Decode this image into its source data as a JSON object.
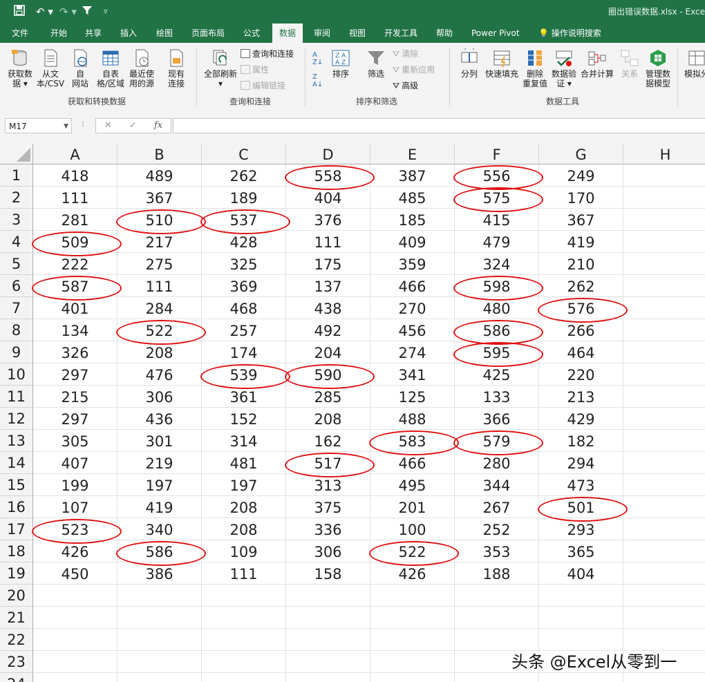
{
  "titlebar": {
    "filename": "圈出错误数据.xlsx",
    "app": "Exce"
  },
  "tabs": [
    "文件",
    "开始",
    "共享",
    "插入",
    "绘图",
    "页面布局",
    "公式",
    "数据",
    "审阅",
    "视图",
    "开发工具",
    "帮助",
    "Power Pivot",
    "操作说明搜索"
  ],
  "active_tab": "数据",
  "ribbon": {
    "get_data": "获取数\n据",
    "from_csv": "从文\n本/CSV",
    "from_web": "自\n网站",
    "from_table": "自表\n格/区域",
    "recent_sources": "最近使\n用的源",
    "existing": "现有\n连接",
    "group_get": "获取和转换数据",
    "refresh_all": "全部刷新",
    "queries_conn": "查询和连接",
    "properties": "属性",
    "edit_links": "编辑链接",
    "group_queries": "查询和连接",
    "sort_az": "A→Z",
    "sort": "排序",
    "filter": "筛选",
    "clear": "清除",
    "reapply": "重新应用",
    "advanced": "高级",
    "group_sort": "排序和筛选",
    "text_to_col": "分列",
    "flash_fill": "快速填充",
    "remove_dup": "删除\n重复值",
    "validation": "数据验\n证",
    "consolidate": "合并计算",
    "relationships": "关系",
    "data_model": "管理数\n据模型",
    "group_tools": "数据工具",
    "whatif": "模拟分"
  },
  "namebox": "M17",
  "formula_icons": {
    "cancel": "✕",
    "enter": "✓",
    "fx": "fx"
  },
  "columns": [
    "A",
    "B",
    "C",
    "D",
    "E",
    "F",
    "G",
    "H"
  ],
  "row_numbers": [
    "1",
    "2",
    "3",
    "4",
    "5",
    "6",
    "7",
    "8",
    "9",
    "10",
    "11",
    "12",
    "13",
    "14",
    "15",
    "16",
    "17",
    "18",
    "19",
    "20",
    "21",
    "22",
    "23",
    "24"
  ],
  "rows": [
    [
      "418",
      "489",
      "262",
      "558",
      "387",
      "556",
      "249"
    ],
    [
      "111",
      "367",
      "189",
      "404",
      "485",
      "575",
      "170"
    ],
    [
      "281",
      "510",
      "537",
      "376",
      "185",
      "415",
      "367"
    ],
    [
      "509",
      "217",
      "428",
      "111",
      "409",
      "479",
      "419"
    ],
    [
      "222",
      "275",
      "325",
      "175",
      "359",
      "324",
      "210"
    ],
    [
      "587",
      "111",
      "369",
      "137",
      "466",
      "598",
      "262"
    ],
    [
      "401",
      "284",
      "468",
      "438",
      "270",
      "480",
      "576"
    ],
    [
      "134",
      "522",
      "257",
      "492",
      "456",
      "586",
      "266"
    ],
    [
      "326",
      "208",
      "174",
      "204",
      "274",
      "595",
      "464"
    ],
    [
      "297",
      "476",
      "539",
      "590",
      "341",
      "425",
      "220"
    ],
    [
      "215",
      "306",
      "361",
      "285",
      "125",
      "133",
      "213"
    ],
    [
      "297",
      "436",
      "152",
      "208",
      "488",
      "366",
      "429"
    ],
    [
      "305",
      "301",
      "314",
      "162",
      "583",
      "579",
      "182"
    ],
    [
      "407",
      "219",
      "481",
      "517",
      "466",
      "280",
      "294"
    ],
    [
      "199",
      "197",
      "197",
      "313",
      "495",
      "344",
      "473"
    ],
    [
      "107",
      "419",
      "208",
      "375",
      "201",
      "267",
      "501"
    ],
    [
      "523",
      "340",
      "208",
      "336",
      "100",
      "252",
      "293"
    ],
    [
      "426",
      "586",
      "109",
      "306",
      "522",
      "353",
      "365"
    ],
    [
      "450",
      "386",
      "111",
      "158",
      "426",
      "188",
      "404"
    ]
  ],
  "circled": [
    [
      0,
      3
    ],
    [
      0,
      5
    ],
    [
      1,
      5
    ],
    [
      2,
      1
    ],
    [
      2,
      2
    ],
    [
      3,
      0
    ],
    [
      5,
      0
    ],
    [
      5,
      5
    ],
    [
      6,
      6
    ],
    [
      7,
      1
    ],
    [
      7,
      5
    ],
    [
      8,
      5
    ],
    [
      9,
      2
    ],
    [
      9,
      3
    ],
    [
      12,
      4
    ],
    [
      12,
      5
    ],
    [
      13,
      3
    ],
    [
      15,
      6
    ],
    [
      16,
      0
    ],
    [
      17,
      1
    ],
    [
      17,
      4
    ]
  ],
  "ring_color": "#e01010",
  "accent_color": "#217346",
  "watermark": "头条 @Excel从零到一"
}
